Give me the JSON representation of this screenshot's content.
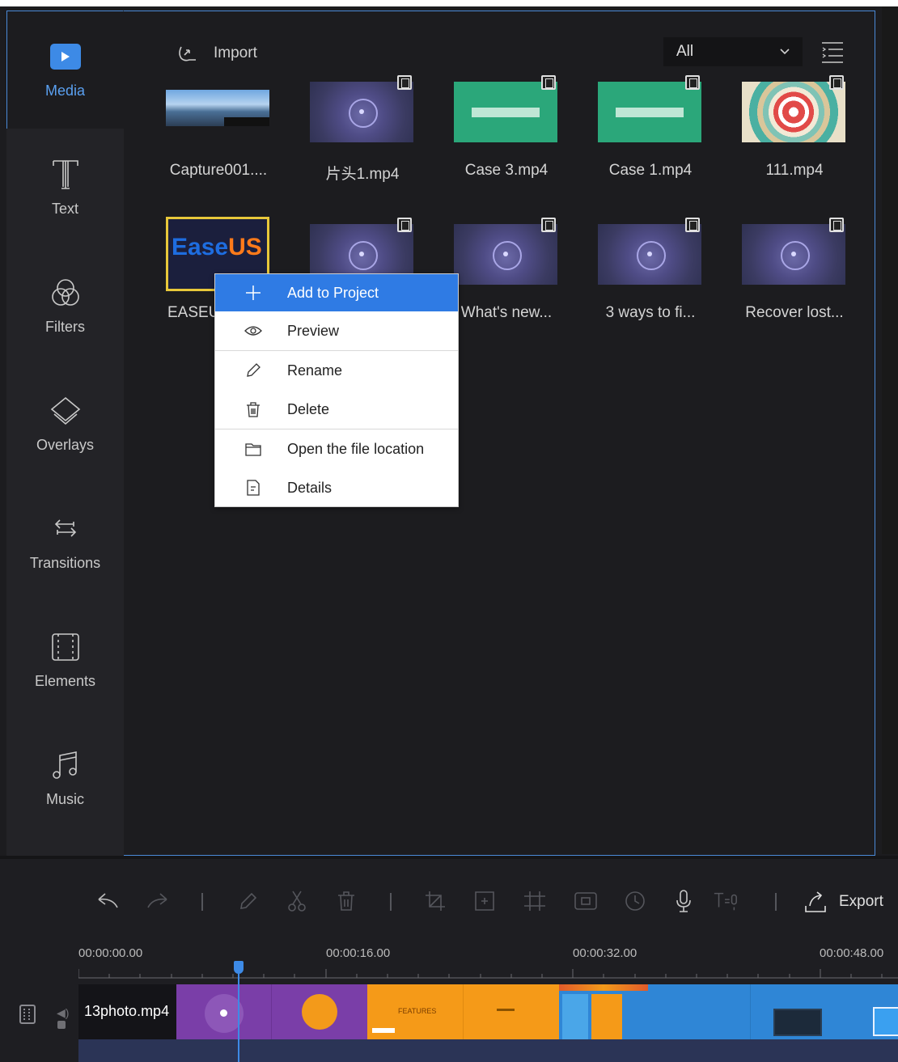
{
  "sidebar": {
    "items": [
      {
        "label": "Media",
        "icon": "media-icon",
        "active": true
      },
      {
        "label": "Text",
        "icon": "text-icon"
      },
      {
        "label": "Filters",
        "icon": "filters-icon"
      },
      {
        "label": "Overlays",
        "icon": "overlays-icon"
      },
      {
        "label": "Transitions",
        "icon": "transitions-icon"
      },
      {
        "label": "Elements",
        "icon": "elements-icon"
      },
      {
        "label": "Music",
        "icon": "music-icon"
      }
    ]
  },
  "media": {
    "import_label": "Import",
    "filter_value": "All",
    "files": [
      {
        "name": "Capture001....",
        "thumb": "capture",
        "is_video": false
      },
      {
        "name": "片头1.mp4",
        "thumb": "purple",
        "is_video": true
      },
      {
        "name": "Case 3.mp4",
        "thumb": "green",
        "is_video": true
      },
      {
        "name": "Case 1.mp4",
        "thumb": "green",
        "is_video": true
      },
      {
        "name": "111.mp4",
        "thumb": "target",
        "is_video": true
      },
      {
        "name": "EASEU",
        "thumb": "easeus",
        "is_video": false
      },
      {
        "name": "",
        "thumb": "purple",
        "is_video": true
      },
      {
        "name": "What's new...",
        "thumb": "purple",
        "is_video": true
      },
      {
        "name": "3 ways to fi...",
        "thumb": "purple",
        "is_video": true
      },
      {
        "name": "Recover lost...",
        "thumb": "purple",
        "is_video": true
      }
    ],
    "easeus_logo": "EaseUS"
  },
  "context_menu": {
    "items": [
      {
        "label": "Add to Project",
        "icon": "plus-icon",
        "highlighted": true
      },
      {
        "label": "Preview",
        "icon": "eye-icon"
      },
      {
        "label": "Rename",
        "icon": "pencil-icon"
      },
      {
        "label": "Delete",
        "icon": "trash-icon"
      },
      {
        "label": "Open the file location",
        "icon": "folder-icon"
      },
      {
        "label": "Details",
        "icon": "details-icon"
      }
    ]
  },
  "toolbar": {
    "export_label": "Export",
    "tools": [
      "undo-icon",
      "redo-icon",
      "edit-icon",
      "cut-icon",
      "delete-icon",
      "crop-icon",
      "zoom-icon",
      "mosaic-icon",
      "freeze-frame-icon",
      "speed-icon",
      "record-voice-icon",
      "text-to-speech-icon"
    ]
  },
  "timeline": {
    "timecodes": [
      "00:00:00.00",
      "00:00:16.00",
      "00:00:32.00",
      "00:00:48.00"
    ],
    "clip_label": "13photo.mp4",
    "clip_text": "FEATURES"
  },
  "colors": {
    "accent": "#3d8ae6",
    "menu_highlight": "#2f7be4",
    "panel_bg": "#1c1c1f",
    "clip_purple": "#7a3ea8",
    "clip_orange": "#f59a18",
    "clip_blue": "#2f86d6"
  }
}
